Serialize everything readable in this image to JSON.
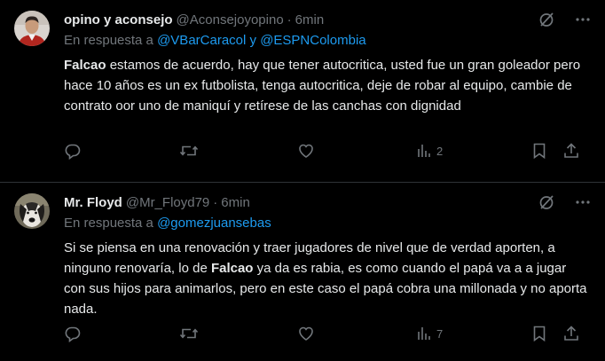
{
  "tweets": [
    {
      "name": "opino y aconsejo",
      "handle": "@Aconsejoyopino",
      "dot": "·",
      "time": "6min",
      "reply_prefix": "En respuesta a",
      "reply_mention_1": "@VBarCaracol",
      "reply_joiner": "y",
      "reply_mention_2": "@ESPNColombia",
      "body_bold": "Falcao",
      "body_rest": " estamos de acuerdo, hay que tener autocritica, usted fue un gran goleador pero hace 10 años es un ex futbolista, tenga autocritica, deje de robar al equipo, cambie de contrato oor uno de maniquí y retírese de las canchas con dignidad",
      "views": "2",
      "icons": [
        "grok-icon",
        "more-icon",
        "reply-icon",
        "retweet-icon",
        "like-icon",
        "views-icon",
        "bookmark-icon",
        "share-icon"
      ]
    },
    {
      "name": "Mr. Floyd",
      "handle": "@Mr_Floyd79",
      "dot": "·",
      "time": "6min",
      "reply_prefix": "En respuesta a",
      "reply_mention_1": "@gomezjuansebas",
      "body_pre": "Si se piensa en una renovación y traer jugadores de nivel que de verdad aporten, a ninguno renovaría, lo de ",
      "body_bold": "Falcao",
      "body_post": " ya da es rabia, es como cuando el papá va a a jugar con sus hijos para animarlos, pero en este caso el papá cobra una millonada y no aporta nada.",
      "views": "7",
      "icons": [
        "grok-icon",
        "more-icon",
        "reply-icon",
        "retweet-icon",
        "like-icon",
        "views-icon",
        "bookmark-icon",
        "share-icon"
      ]
    }
  ]
}
